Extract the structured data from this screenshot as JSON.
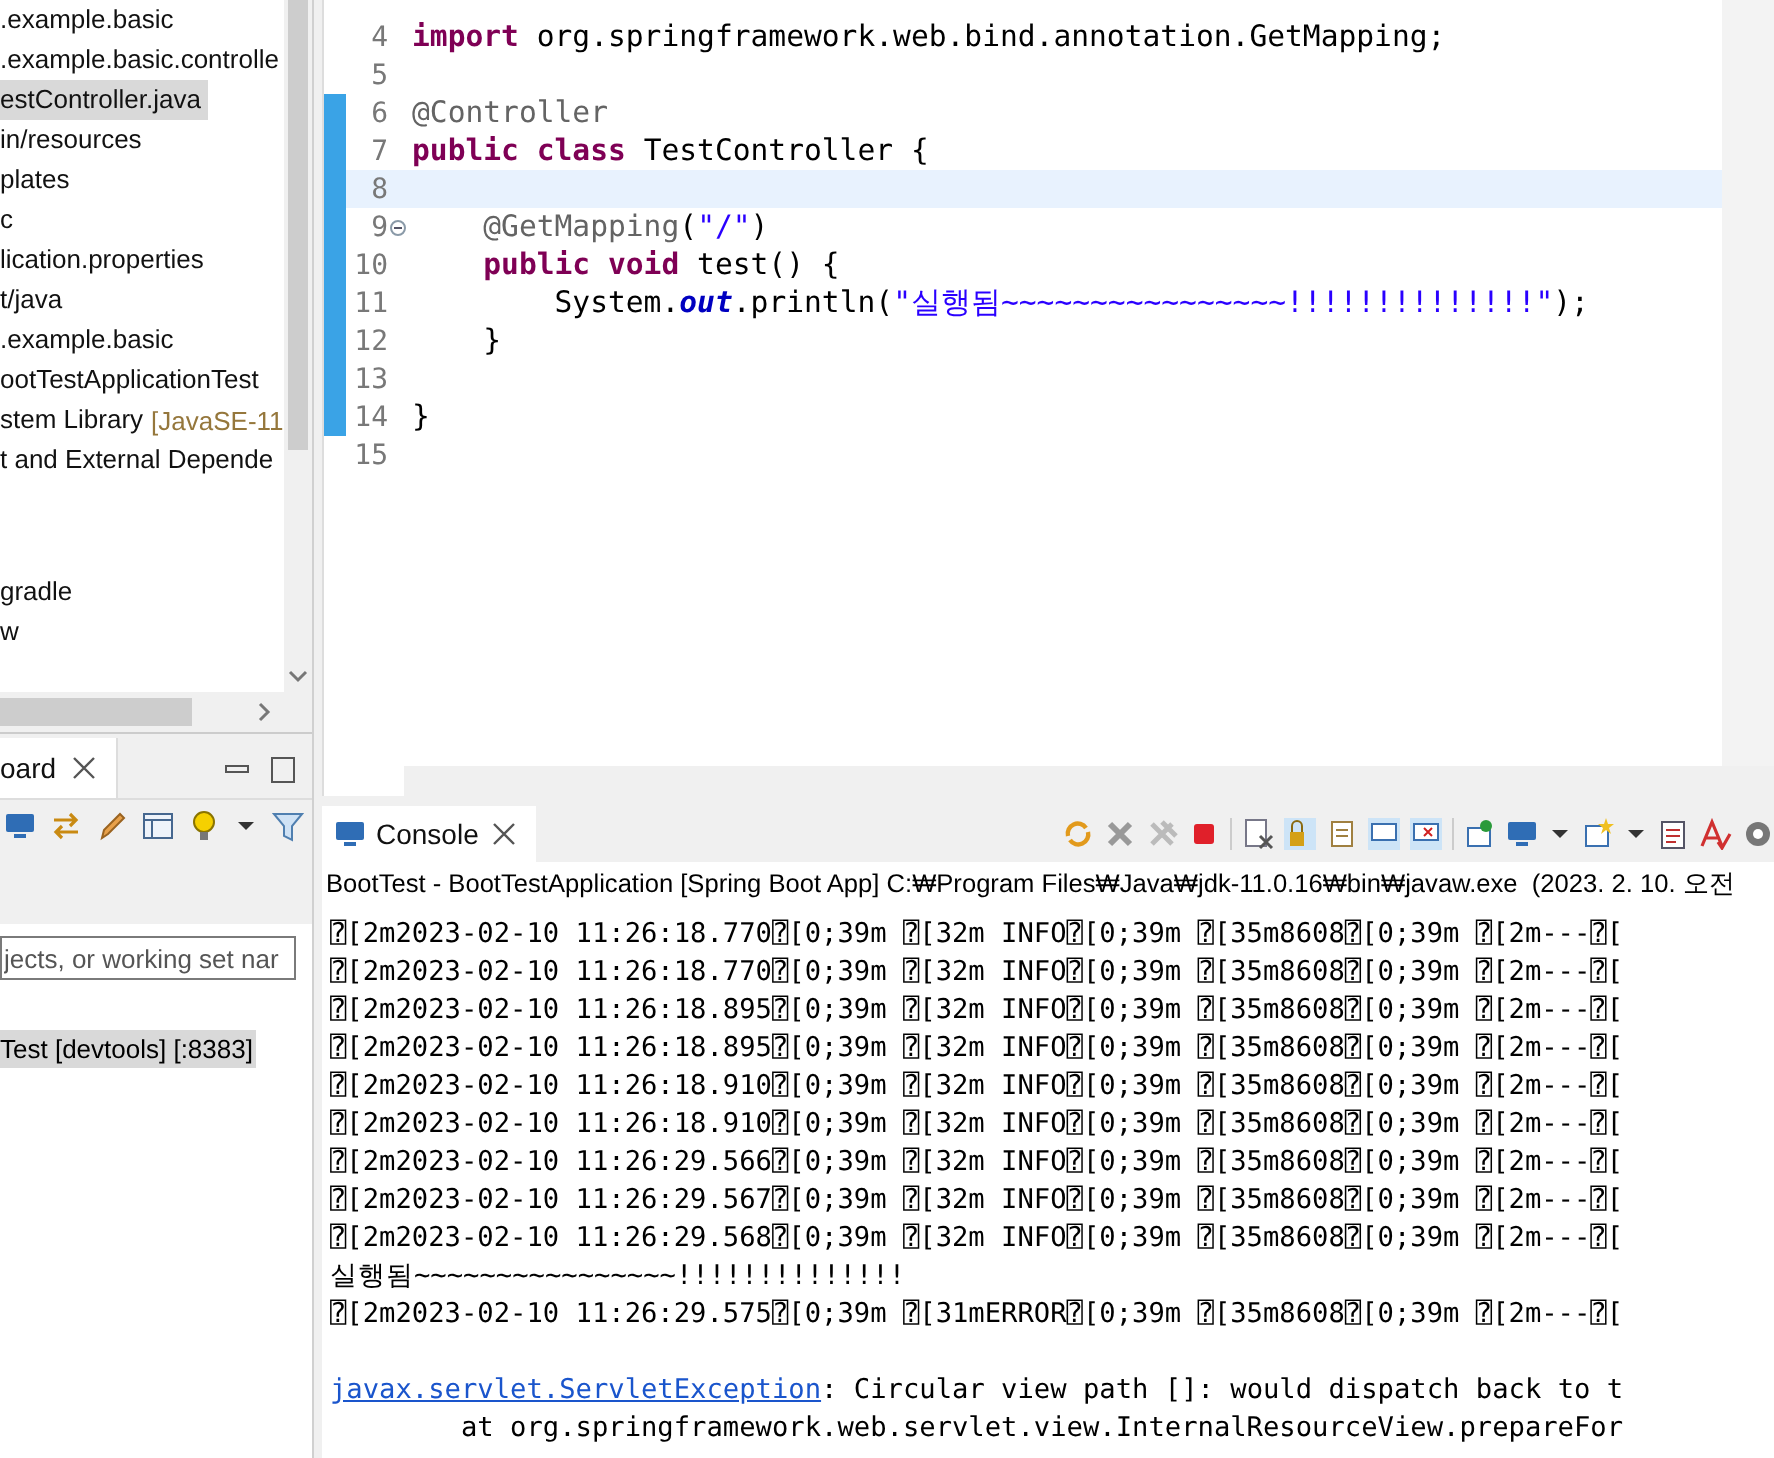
{
  "project_explorer": {
    "rows": [
      {
        "label": ".example.basic",
        "selected": false
      },
      {
        "label": ".example.basic.controlle",
        "selected": false
      },
      {
        "label": "estController.java",
        "selected": true
      },
      {
        "label": "in/resources",
        "selected": false
      },
      {
        "label": "plates",
        "selected": false
      },
      {
        "label": "c",
        "selected": false
      },
      {
        "label": "lication.properties",
        "selected": false
      },
      {
        "label": "t/java",
        "selected": false
      },
      {
        "label": ".example.basic",
        "selected": false
      },
      {
        "label": "ootTestApplicationTest",
        "selected": false
      },
      {
        "label": "stem Library",
        "suffix": "[JavaSE-11",
        "selected": false
      },
      {
        "label": "t and External Depende",
        "selected": false
      }
    ],
    "bottom_rows": [
      {
        "label": "gradle",
        "selected": false
      },
      {
        "label": "w",
        "selected": false
      }
    ]
  },
  "boot_dashboard": {
    "tab": {
      "label": "oard"
    },
    "filter": {
      "placeholder": "jects, or working set nar"
    },
    "items": [
      {
        "label": "Test [devtools] [:8383]",
        "selected": true
      }
    ]
  },
  "editor": {
    "lines": [
      {
        "number": "4",
        "changed": false,
        "current": false,
        "fold": false,
        "tokens": [
          {
            "kind": "keyword",
            "text": "import"
          },
          {
            "kind": "plain",
            "text": " org.springframework.web.bind.annotation.GetMapping;"
          }
        ]
      },
      {
        "number": "5",
        "changed": false,
        "current": false,
        "fold": false
      },
      {
        "number": "6",
        "changed": true,
        "current": false,
        "fold": false,
        "tokens": [
          {
            "kind": "annotation",
            "text": "@Controller"
          }
        ]
      },
      {
        "number": "7",
        "changed": true,
        "current": false,
        "fold": false,
        "tokens": [
          {
            "kind": "keyword",
            "text": "public class"
          },
          {
            "kind": "plain",
            "text": " TestController {"
          }
        ]
      },
      {
        "number": "8",
        "changed": true,
        "current": true,
        "fold": false
      },
      {
        "number": "9",
        "changed": true,
        "current": false,
        "fold": true,
        "tokens": [
          {
            "kind": "annotation",
            "text": "    @GetMapping"
          },
          {
            "kind": "plain",
            "text": "("
          },
          {
            "kind": "string",
            "text": "\"/\""
          },
          {
            "kind": "plain",
            "text": ")"
          }
        ]
      },
      {
        "number": "10",
        "changed": true,
        "current": false,
        "fold": false,
        "tokens": [
          {
            "kind": "keyword",
            "text": "    public void"
          },
          {
            "kind": "plain",
            "text": " test() {"
          }
        ]
      },
      {
        "number": "11",
        "changed": true,
        "current": false,
        "fold": false,
        "tokens": [
          {
            "kind": "plain",
            "text": "        System."
          },
          {
            "kind": "field",
            "text": "out"
          },
          {
            "kind": "plain",
            "text": ".println("
          },
          {
            "kind": "string",
            "text": "\"실행됨~~~~~~~~~~~~~~~~!!!!!!!!!!!!!!\""
          },
          {
            "kind": "plain",
            "text": ");"
          }
        ]
      },
      {
        "number": "12",
        "changed": true,
        "current": false,
        "fold": false,
        "tokens": [
          {
            "kind": "plain",
            "text": "    }"
          }
        ]
      },
      {
        "number": "13",
        "changed": true,
        "current": false,
        "fold": false
      },
      {
        "number": "14",
        "changed": true,
        "current": false,
        "fold": false,
        "tokens": [
          {
            "kind": "plain",
            "text": "}"
          }
        ]
      },
      {
        "number": "15",
        "changed": false,
        "current": false,
        "fold": false
      }
    ]
  },
  "console": {
    "tab": {
      "label": "Console"
    },
    "header": "BootTest - BootTestApplication [Spring Boot App] C:₩Program Files₩Java₩jdk-11.0.16₩bin₩javaw.exe  (2023. 2. 10. 오전",
    "lines": [
      {
        "kind": "plain",
        "text": "⍰[2m2023-02-10 11:26:18.770⍰[0;39m ⍰[32m INFO⍰[0;39m ⍰[35m8608⍰[0;39m ⍰[2m---⍰["
      },
      {
        "kind": "plain",
        "text": "⍰[2m2023-02-10 11:26:18.770⍰[0;39m ⍰[32m INFO⍰[0;39m ⍰[35m8608⍰[0;39m ⍰[2m---⍰["
      },
      {
        "kind": "plain",
        "text": "⍰[2m2023-02-10 11:26:18.895⍰[0;39m ⍰[32m INFO⍰[0;39m ⍰[35m8608⍰[0;39m ⍰[2m---⍰["
      },
      {
        "kind": "plain",
        "text": "⍰[2m2023-02-10 11:26:18.895⍰[0;39m ⍰[32m INFO⍰[0;39m ⍰[35m8608⍰[0;39m ⍰[2m---⍰["
      },
      {
        "kind": "plain",
        "text": "⍰[2m2023-02-10 11:26:18.910⍰[0;39m ⍰[32m INFO⍰[0;39m ⍰[35m8608⍰[0;39m ⍰[2m---⍰["
      },
      {
        "kind": "plain",
        "text": "⍰[2m2023-02-10 11:26:18.910⍰[0;39m ⍰[32m INFO⍰[0;39m ⍰[35m8608⍰[0;39m ⍰[2m---⍰["
      },
      {
        "kind": "plain",
        "text": "⍰[2m2023-02-10 11:26:29.566⍰[0;39m ⍰[32m INFO⍰[0;39m ⍰[35m8608⍰[0;39m ⍰[2m---⍰["
      },
      {
        "kind": "plain",
        "text": "⍰[2m2023-02-10 11:26:29.567⍰[0;39m ⍰[32m INFO⍰[0;39m ⍰[35m8608⍰[0;39m ⍰[2m---⍰["
      },
      {
        "kind": "plain",
        "text": "⍰[2m2023-02-10 11:26:29.568⍰[0;39m ⍰[32m INFO⍰[0;39m ⍰[35m8608⍰[0;39m ⍰[2m---⍰["
      },
      {
        "kind": "plain",
        "text": "실행됨~~~~~~~~~~~~~~~~!!!!!!!!!!!!!!"
      },
      {
        "kind": "plain",
        "text": "⍰[2m2023-02-10 11:26:29.575⍰[0;39m ⍰[31mERROR⍰[0;39m ⍰[35m8608⍰[0;39m ⍰[2m---⍰["
      },
      {
        "kind": "blank"
      },
      {
        "kind": "exception",
        "link": "javax.servlet.ServletException",
        "text": ": Circular view path []: would dispatch back to t"
      },
      {
        "kind": "plain",
        "text": "        at org.springframework.web.servlet.view.InternalResourceView.prepareFor"
      }
    ]
  }
}
